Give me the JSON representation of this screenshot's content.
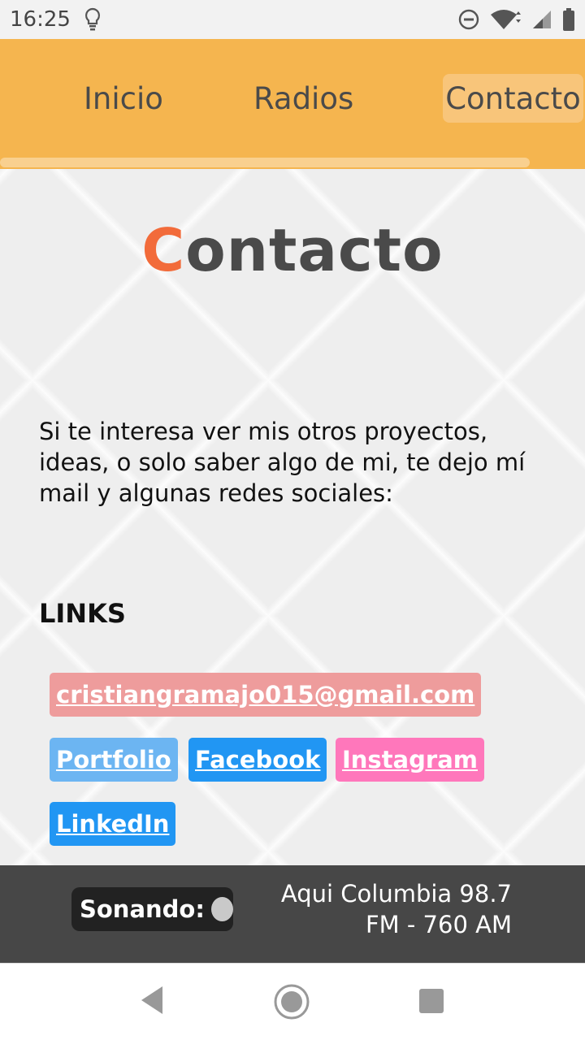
{
  "status_bar": {
    "time": "16:25",
    "icons": [
      "lightbulb-icon",
      "do-not-disturb-icon",
      "wifi-icon",
      "signal-icon",
      "battery-icon"
    ]
  },
  "nav": {
    "tabs": [
      {
        "label": "Inicio",
        "active": false
      },
      {
        "label": "Radios",
        "active": false
      },
      {
        "label": "Contacto",
        "active": true
      }
    ]
  },
  "page": {
    "title_first": "C",
    "title_rest": "ontacto",
    "intro": "Si te interesa ver mis otros proyectos, ideas, o solo saber algo de mi, te dejo mí mail y algunas redes sociales:",
    "links_heading": "LINKS",
    "links": {
      "email": "cristiangramajo015@gmail.com",
      "portfolio": "Portfolio",
      "facebook": "Facebook",
      "instagram": "Instagram",
      "linkedin": "LinkedIn"
    }
  },
  "player": {
    "status_label": "Sonando:",
    "station_line1": "Aqui Columbia 98.7",
    "station_line2": "FM - 760 AM"
  },
  "colors": {
    "nav_bg": "#f5b54f",
    "title_accent": "#f26b3a",
    "email_btn": "#ee9c9c",
    "portfolio_btn": "#6cb5f2",
    "facebook_btn": "#2196f3",
    "instagram_btn": "#ff77bb",
    "linkedin_btn": "#2196f3",
    "player_bg": "#474747"
  },
  "system_nav": [
    "back-icon",
    "home-icon",
    "recents-icon"
  ]
}
